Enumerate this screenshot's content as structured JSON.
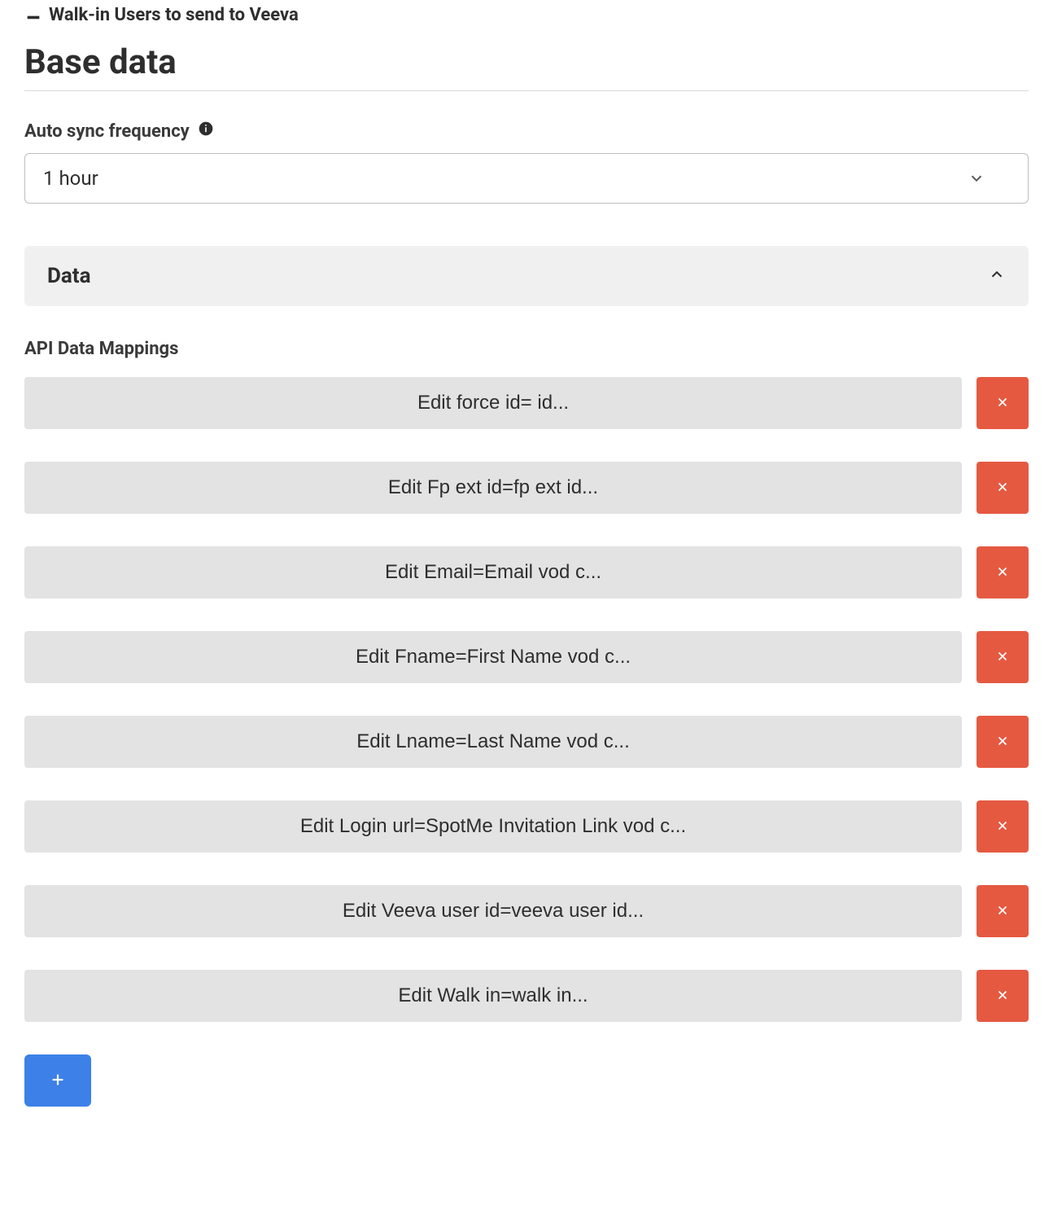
{
  "header": {
    "crumb_text": "Walk-in Users to send to Veeva",
    "page_title": "Base data"
  },
  "sync": {
    "label": "Auto sync frequency",
    "selected": "1 hour"
  },
  "data_section": {
    "title": "Data",
    "api_mappings_label": "API Data Mappings",
    "mappings": [
      {
        "label": "Edit force id= id..."
      },
      {
        "label": "Edit Fp ext id=fp ext id..."
      },
      {
        "label": "Edit Email=Email vod c..."
      },
      {
        "label": "Edit Fname=First Name vod c..."
      },
      {
        "label": "Edit Lname=Last Name vod c..."
      },
      {
        "label": "Edit Login url=SpotMe Invitation Link vod c..."
      },
      {
        "label": "Edit Veeva user id=veeva user id..."
      },
      {
        "label": "Edit Walk in=walk in..."
      }
    ]
  }
}
